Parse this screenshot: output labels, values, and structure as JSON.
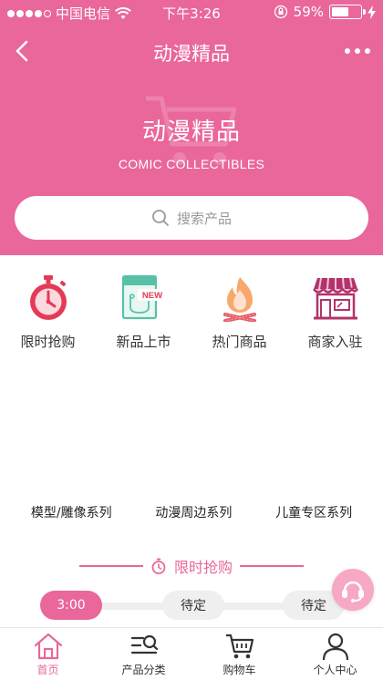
{
  "status_bar": {
    "carrier": "中国电信",
    "time": "下午3:26",
    "battery": "59%",
    "battery_level": 0.59
  },
  "nav": {
    "title": "动漫精品"
  },
  "hero": {
    "title": "动漫精品",
    "subtitle": "COMIC COLLECTIBLES"
  },
  "search": {
    "placeholder": "搜索产品"
  },
  "quick_menu": [
    {
      "label": "限时抢购",
      "icon": "stopwatch-icon"
    },
    {
      "label": "新品上市",
      "icon": "new-pocket-icon",
      "badge": "NEW"
    },
    {
      "label": "热门商品",
      "icon": "fire-icon"
    },
    {
      "label": "商家入驻",
      "icon": "store-icon"
    }
  ],
  "series": [
    "模型/雕像系列",
    "动漫周边系列",
    "儿童专区系列"
  ],
  "flash_sale": {
    "title": "限时抢购",
    "slots": [
      "3:00",
      "待定",
      "待定"
    ]
  },
  "tabbar": [
    {
      "label": "首页",
      "icon": "home-icon",
      "active": true
    },
    {
      "label": "产品分类",
      "icon": "category-icon"
    },
    {
      "label": "购物车",
      "icon": "cart-icon"
    },
    {
      "label": "个人中心",
      "icon": "user-icon"
    }
  ],
  "colors": {
    "brand": "#e9679b",
    "brand_light": "#f6a8c6"
  }
}
